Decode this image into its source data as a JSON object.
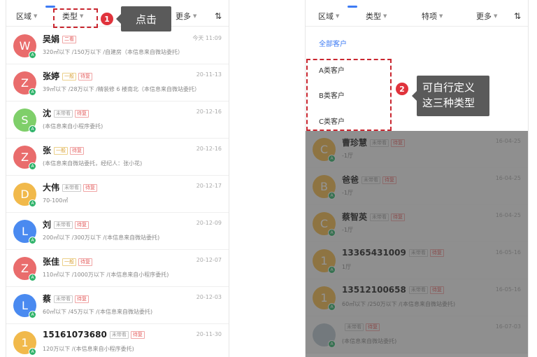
{
  "left": {
    "filters": {
      "region": "区域",
      "type": "类型",
      "more": "更多",
      "sort": "⇅"
    },
    "rows": [
      {
        "avatar": "W",
        "color": "#e96c6c",
        "name": "吴娟",
        "tags": [
          {
            "t": "二看",
            "c": "red"
          }
        ],
        "date": "今天 11:09",
        "desc": "320㎡以下 /150万以下 /自建房（本信息来自微站委托）"
      },
      {
        "avatar": "Z",
        "color": "#e96c6c",
        "name": "张婷",
        "tags": [
          {
            "t": "一般",
            "c": "yellow"
          },
          {
            "t": "待复",
            "c": "red"
          }
        ],
        "date": "20-11-13",
        "desc": "39㎡以下 /28万以下 /精装修 6 楼南北（本信息来自微站委托）"
      },
      {
        "avatar": "S",
        "color": "#7fcf6a",
        "name": "沈",
        "tags": [
          {
            "t": "未带看",
            "c": "gray"
          },
          {
            "t": "待复",
            "c": "red"
          }
        ],
        "date": "20-12-16",
        "desc": "(本信息来自小程序委托)"
      },
      {
        "avatar": "Z",
        "color": "#e96c6c",
        "name": "张",
        "tags": [
          {
            "t": "一般",
            "c": "yellow"
          },
          {
            "t": "待复",
            "c": "red"
          }
        ],
        "date": "20-12-16",
        "desc": "(本信息来自微站委托，经纪人：张小花)"
      },
      {
        "avatar": "D",
        "color": "#f1b94b",
        "name": "大伟",
        "tags": [
          {
            "t": "未带看",
            "c": "gray"
          },
          {
            "t": "待复",
            "c": "red"
          }
        ],
        "date": "20-12-17",
        "desc": "70-100㎡"
      },
      {
        "avatar": "L",
        "color": "#4a8af0",
        "name": "刘",
        "tags": [
          {
            "t": "未带看",
            "c": "gray"
          },
          {
            "t": "待复",
            "c": "red"
          }
        ],
        "date": "20-12-09",
        "desc": "200㎡以下 /300万以下 /(本信息来自微站委托)"
      },
      {
        "avatar": "Z",
        "color": "#e96c6c",
        "name": "张佳",
        "tags": [
          {
            "t": "一般",
            "c": "yellow"
          },
          {
            "t": "待复",
            "c": "red"
          }
        ],
        "date": "20-12-07",
        "desc": "110㎡以下 /1000万以下 /(本信息来自小程序委托)"
      },
      {
        "avatar": "L",
        "color": "#4a8af0",
        "name": "蔡",
        "tags": [
          {
            "t": "未带看",
            "c": "gray"
          },
          {
            "t": "待复",
            "c": "red"
          }
        ],
        "date": "20-12-03",
        "desc": "60㎡以下 /45万以下 /(本信息来自微站委托)"
      },
      {
        "avatar": "1",
        "color": "#f1b94b",
        "name": "15161073680",
        "tags": [
          {
            "t": "未带看",
            "c": "gray"
          },
          {
            "t": "待复",
            "c": "red"
          }
        ],
        "date": "20-11-30",
        "desc": "120万以下 /(本信息来自小程序委托)"
      }
    ]
  },
  "right": {
    "filters": {
      "region": "区域",
      "type": "类型",
      "special": "特项",
      "more": "更多",
      "sort": "⇅"
    },
    "menu": {
      "all": "全部客户",
      "a": "A类客户",
      "b": "B类客户",
      "c": "C类客户"
    },
    "rows": [
      {
        "avatar": "C",
        "color": "#f1b94b",
        "name": "曹珍慧",
        "tags": [
          {
            "t": "未带看",
            "c": "gray"
          },
          {
            "t": "待复",
            "c": "red"
          }
        ],
        "date": "16-04-25",
        "desc": "-1厅"
      },
      {
        "avatar": "B",
        "color": "#f1b94b",
        "name": "爸爸",
        "tags": [
          {
            "t": "未带看",
            "c": "gray"
          },
          {
            "t": "待复",
            "c": "red"
          }
        ],
        "date": "16-04-25",
        "desc": "-1厅"
      },
      {
        "avatar": "C",
        "color": "#f1b94b",
        "name": "蔡智英",
        "tags": [
          {
            "t": "未带看",
            "c": "gray"
          },
          {
            "t": "待复",
            "c": "red"
          }
        ],
        "date": "16-04-25",
        "desc": "-1厅"
      },
      {
        "avatar": "1",
        "color": "#f1b94b",
        "name": "13365431009",
        "tags": [
          {
            "t": "未带看",
            "c": "gray"
          },
          {
            "t": "待复",
            "c": "red"
          }
        ],
        "date": "16-05-16",
        "desc": "1厅"
      },
      {
        "avatar": "1",
        "color": "#f1b94b",
        "name": "13512100658",
        "tags": [
          {
            "t": "未带看",
            "c": "gray"
          },
          {
            "t": "待复",
            "c": "red"
          }
        ],
        "date": "16-05-16",
        "desc": "60㎡以下 /250万以下 /(本信息来自微站委托)"
      },
      {
        "avatar": "",
        "color": "#b7c3cc",
        "name": "",
        "tags": [
          {
            "t": "未带看",
            "c": "gray"
          },
          {
            "t": "待复",
            "c": "red"
          }
        ],
        "date": "16-07-03",
        "desc": "(本信息来自微站委托)"
      }
    ]
  },
  "annotations": {
    "step1": "1",
    "tip1": "点击",
    "step2": "2",
    "tip2_line1": "可自行定义",
    "tip2_line2": "这三种类型"
  }
}
